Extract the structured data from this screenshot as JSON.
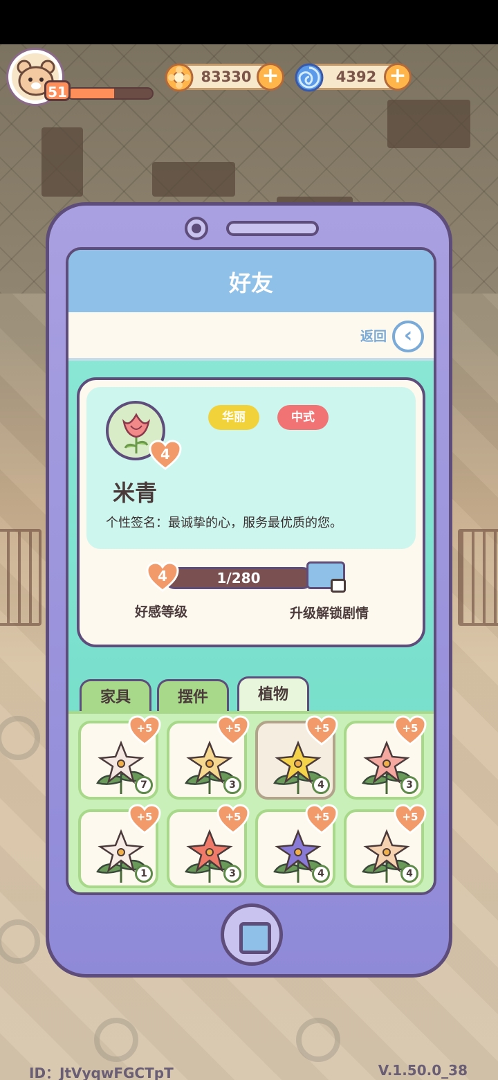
{
  "hud": {
    "player_level": "51",
    "exp_progress": 0.55,
    "currencies": [
      {
        "name": "gold",
        "icon": "flower-coin-icon",
        "value": "83330",
        "color": "#ffb54a"
      },
      {
        "name": "gem",
        "icon": "swirl-gem-icon",
        "value": "4392",
        "color": "#5a9ae8"
      }
    ],
    "add_symbol": "+"
  },
  "screen": {
    "title": "好友",
    "back_label": "返回",
    "back_icon": "chevron-left-icon"
  },
  "profile": {
    "portrait_icon": "rose-icon",
    "affection_level": "4",
    "tags": [
      "华丽",
      "中式"
    ],
    "name": "米青",
    "signature_label": "个性签名：",
    "signature_text": "最诚挚的心，服务最优质的您。",
    "affection": {
      "level": "4",
      "progress_text": "1/280",
      "level_label": "好感等级",
      "unlock_label": "升级解锁剧情"
    }
  },
  "tabs": [
    {
      "label": "家具",
      "active": false
    },
    {
      "label": "摆件",
      "active": false
    },
    {
      "label": "植物",
      "active": true
    }
  ],
  "items": [
    {
      "icon": "white-rose-icon",
      "bonus": "+5",
      "count": "7",
      "color": "#f4e6e0"
    },
    {
      "icon": "yellow-lily-icon",
      "bonus": "+5",
      "count": "3",
      "color": "#f6d890"
    },
    {
      "icon": "yellow-flower-bush-icon",
      "bonus": "+5",
      "count": "4",
      "color": "#f4d24a"
    },
    {
      "icon": "pink-lily-icon",
      "bonus": "+5",
      "count": "3",
      "color": "#f4a8a0"
    },
    {
      "icon": "white-lily-icon",
      "bonus": "+5",
      "count": "1",
      "color": "#f8ece6"
    },
    {
      "icon": "red-lily-icon",
      "bonus": "+5",
      "count": "3",
      "color": "#f07a6a"
    },
    {
      "icon": "purple-carnation-icon",
      "bonus": "+5",
      "count": "4",
      "color": "#8a7ad8"
    },
    {
      "icon": "peach-carnation-icon",
      "bonus": "+5",
      "count": "4",
      "color": "#f6d2b0"
    }
  ],
  "footer": {
    "id_text": "ID：JtVyqwFGCTpT",
    "version": "V.1.50.0_38"
  }
}
